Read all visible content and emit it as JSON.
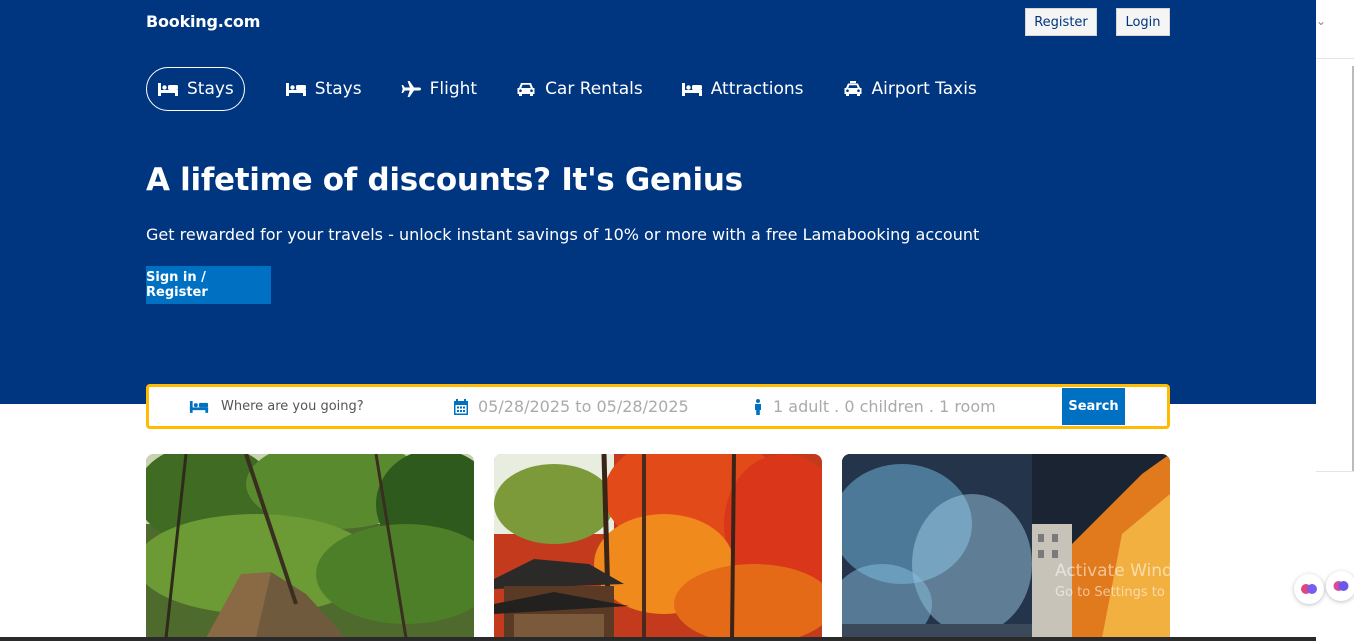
{
  "header": {
    "logo": "Booking.com",
    "register_label": "Register",
    "login_label": "Login"
  },
  "nav_tabs": [
    {
      "label": "Stays",
      "icon": "bed-icon",
      "active": true
    },
    {
      "label": "Stays",
      "icon": "bed-icon",
      "active": false
    },
    {
      "label": "Flight",
      "icon": "plane-icon",
      "active": false
    },
    {
      "label": "Car Rentals",
      "icon": "car-icon",
      "active": false
    },
    {
      "label": "Attractions",
      "icon": "bed-icon",
      "active": false
    },
    {
      "label": "Airport Taxis",
      "icon": "taxi-icon",
      "active": false
    }
  ],
  "hero": {
    "title": "A lifetime of discounts? It's Genius",
    "subtitle": "Get rewarded for your travels - unlock instant savings of 10% or more with a free Lamabooking account",
    "cta_label": "Sign in / Register"
  },
  "search": {
    "destination_placeholder": "Where are you going?",
    "dates": "05/28/2025 to 05/28/2025",
    "guests": "1 adult . 0 children . 1 room",
    "button_label": "Search"
  },
  "watermark": {
    "title": "Activate Windows",
    "subtitle": "Go to Settings to activate Windows."
  },
  "colors": {
    "brand_blue": "#003580",
    "accent_blue": "#0071c2",
    "search_border": "#febb02"
  }
}
